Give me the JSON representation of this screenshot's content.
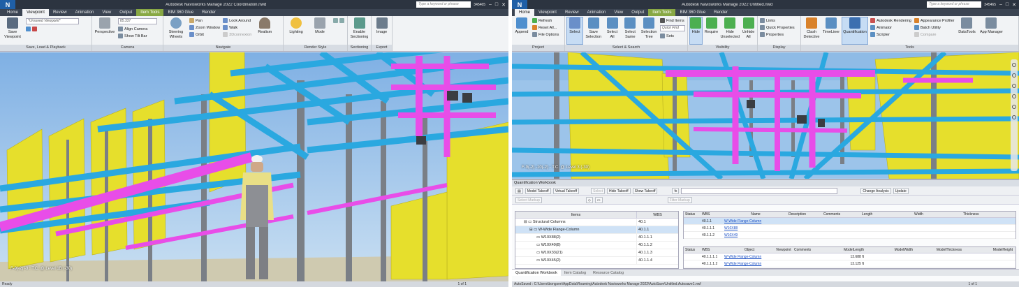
{
  "left": {
    "title": "Autodesk Navisworks Manage 2022    Coordination.nwd",
    "search_placeholder": "Type a keyword or phrase",
    "user": "345465",
    "tabs": [
      "Home",
      "Viewpoint",
      "Review",
      "Animation",
      "View",
      "Output",
      "Item Tools",
      "BIM 360 Glue",
      "Render"
    ],
    "active_tab": "Viewpoint",
    "panels": {
      "save": {
        "label": "Save, Load & Playback",
        "save_viewpoint": "Save Viewpoint",
        "viewpoint_input": "*Unsaved Viewpoint*"
      },
      "camera": {
        "label": "Camera",
        "perspective": "Perspective",
        "field_value": "85.337",
        "align": "Align Camera",
        "tilt": "Show Tilt Bar"
      },
      "navigate": {
        "label": "Navigate",
        "steering": "Steering Wheels",
        "pan": "Pan",
        "zoom": "Zoom Window",
        "orbit": "Orbit",
        "look": "Look Around",
        "walk": "Walk",
        "connexion": "3Dconnexion",
        "realism": "Realism"
      },
      "render": {
        "label": "Render Style",
        "lighting": "Lighting",
        "mode": "Mode"
      },
      "sectioning": {
        "label": "Sectioning",
        "enable": "Enable Sectioning"
      },
      "export": {
        "label": "Export",
        "image": "Image"
      }
    },
    "viewport_label": "F-9(-2) -9 : T.C. @ Level 1B (-30)",
    "status": "Ready",
    "status_right": "1 of 1"
  },
  "right": {
    "title": "Autodesk Navisworks Manage 2022    Untitled.nwd",
    "search_placeholder": "Type a keyword or phrase",
    "user": "345465",
    "tabs": [
      "Home",
      "Viewpoint",
      "Review",
      "Animation",
      "View",
      "Output",
      "Item Tools",
      "BIM 360 Glue",
      "Render"
    ],
    "active_tab": "Home",
    "panels": {
      "project": {
        "label": "Project",
        "append": "Append",
        "refresh": "Refresh",
        "reset": "Reset All...",
        "file_options": "File Options"
      },
      "select": {
        "label": "Select & Search",
        "select": "Select",
        "save_sel": "Save Selection",
        "select_all": "Select All",
        "select_same": "Select Same",
        "sel_tree": "Selection Tree",
        "find_items": "Find Items",
        "quick_find": "Quick Find",
        "sets": "Sets"
      },
      "visibility": {
        "label": "Visibility",
        "hide": "Hide",
        "require": "Require",
        "hide_unsel": "Hide Unselected",
        "unhide_all": "Unhide All"
      },
      "display": {
        "label": "Display",
        "links": "Links",
        "quick_props": "Quick Properties",
        "props": "Properties"
      },
      "tools": {
        "label": "Tools",
        "clash": "Clash Detective",
        "timeliner": "TimeLiner",
        "quant": "Quantification",
        "rendering": "Autodesk Rendering",
        "animator": "Animator",
        "scripter": "Scripter",
        "appearance": "Appearance Profiler",
        "batch": "Batch Utility",
        "compare": "Compare",
        "datatools": "DataTools",
        "appmgr": "App Manager"
      }
    },
    "viewport_label": "F-9(-2) -10(-2) - T.C. @ Level 3 (-30)",
    "workbook": {
      "title": "Quantification Workbook",
      "toolbar": [
        "Model Takeoff",
        "Virtual Takeoff",
        "Select",
        "Hide Takeoff",
        "Show Takeoff",
        "Change Analysis",
        "Update"
      ],
      "toolbar2": [
        "Select Markup",
        "Filter Markup"
      ],
      "tree_headers": [
        "Items",
        "WBS"
      ],
      "tree_rows": [
        {
          "name": "Structural Columns",
          "wbs": "40.1",
          "indent": 1
        },
        {
          "name": "W-Wide Flange-Column",
          "wbs": "40.1.1",
          "indent": 2,
          "sel": true
        },
        {
          "name": "W10X88(2)",
          "wbs": "40.1.1.1",
          "indent": 3
        },
        {
          "name": "W10X49(8)",
          "wbs": "40.1.1.2",
          "indent": 3
        },
        {
          "name": "W10X33(21)",
          "wbs": "40.1.1.3",
          "indent": 3
        },
        {
          "name": "W10X45(2)",
          "wbs": "40.1.1.4",
          "indent": 3
        }
      ],
      "top_headers": [
        "Status",
        "WBS",
        "Name",
        "Description",
        "Comments",
        "Length",
        "Width",
        "Thickness"
      ],
      "top_rows": [
        [
          "",
          "40.1.1",
          "W-Wide Flange-Column",
          "",
          "",
          "",
          "",
          ""
        ],
        [
          "",
          "40.1.1.1",
          "W10X88",
          "",
          "",
          "",
          "",
          ""
        ],
        [
          "",
          "40.1.1.2",
          "W10X49",
          "",
          "",
          "",
          "",
          ""
        ]
      ],
      "bot_headers": [
        "Status",
        "WBS",
        "Object",
        "Viewpoint",
        "Comments",
        "ModelLength",
        "ModelWidth",
        "ModelThickness",
        "ModelHeight"
      ],
      "bot_rows": [
        [
          "",
          "40.1.1.1.1",
          "W-Wide Flange-Column",
          "",
          "",
          "13.688 ft",
          "",
          "",
          ""
        ],
        [
          "",
          "40.1.1.1.2",
          "W-Wide Flange-Column",
          "",
          "",
          "13.125 ft",
          "",
          "",
          ""
        ]
      ],
      "tabs": [
        "Quantification Workbook",
        "Item Catalog",
        "Resource Catalog"
      ]
    },
    "status": "AutoSaved : C:\\Users\\bongsen\\AppData\\Roaming\\Autodesk Navisworks Manage 2022\\AutoSave\\Untitled.Autosave1.nwf",
    "status_right": "1 of 1"
  },
  "colors": {
    "beam": "#2aa8e0",
    "duct": "#e84de8",
    "wall": "#e8e02a",
    "steel": "#7a7f86",
    "sky": "#9cc4ea",
    "floor": "#d9d4b4"
  }
}
